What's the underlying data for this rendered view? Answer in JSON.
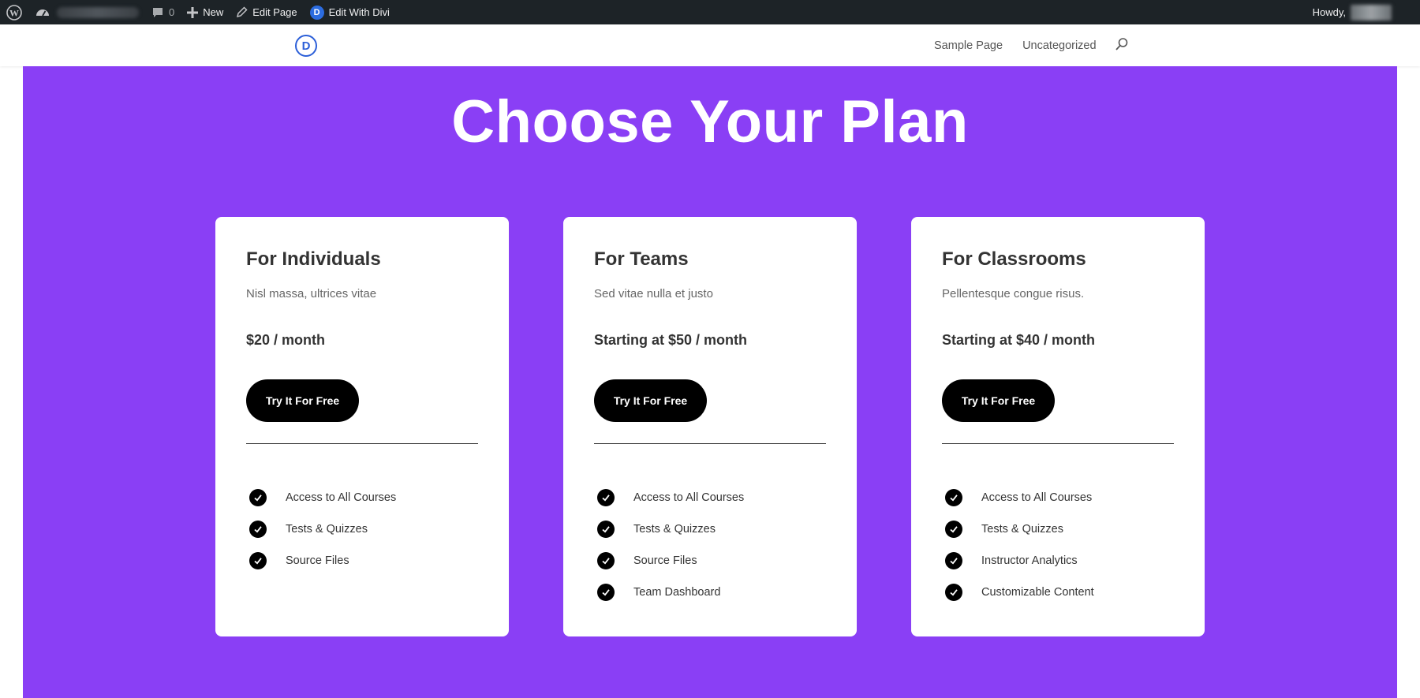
{
  "admin_bar": {
    "comment_count": "0",
    "new_label": "New",
    "edit_page_label": "Edit Page",
    "divi_badge": "D",
    "edit_divi_label": "Edit With Divi",
    "howdy_label": "Howdy,"
  },
  "header": {
    "logo_letter": "D",
    "nav": [
      {
        "label": "Sample Page"
      },
      {
        "label": "Uncategorized"
      }
    ]
  },
  "hero": {
    "title": "Choose Your Plan",
    "background_color": "#8a3ff5"
  },
  "plans": [
    {
      "title": "For Individuals",
      "subtitle": "Nisl massa, ultrices vitae",
      "price": "$20 / month",
      "cta": "Try It For Free",
      "features": [
        "Access to All Courses",
        "Tests & Quizzes",
        "Source Files"
      ]
    },
    {
      "title": "For Teams",
      "subtitle": "Sed vitae nulla et justo",
      "price": "Starting at $50 / month",
      "cta": "Try It For Free",
      "features": [
        "Access to All Courses",
        "Tests & Quizzes",
        "Source Files",
        "Team Dashboard"
      ]
    },
    {
      "title": "For Classrooms",
      "subtitle": "Pellentesque congue risus.",
      "price": "Starting at $40 / month",
      "cta": "Try It For Free",
      "features": [
        "Access to All Courses",
        "Tests & Quizzes",
        "Instructor Analytics",
        "Customizable Content"
      ]
    }
  ]
}
